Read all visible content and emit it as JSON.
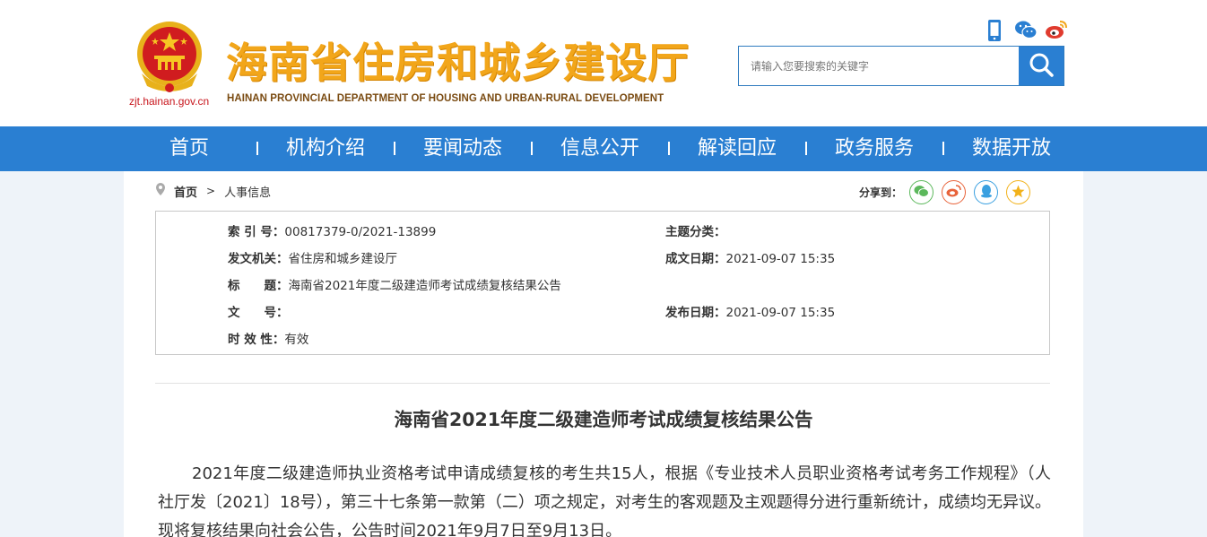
{
  "header": {
    "domain": "zjt.hainan.gov.cn",
    "title": "海南省住房和城乡建设厅",
    "subtitle": "HAINAN PROVINCIAL DEPARTMENT OF HOUSING AND URBAN-RURAL DEVELOPMENT",
    "search_placeholder": "请输入您要搜索的关键字",
    "icons": [
      "mobile-icon",
      "wechat-icon",
      "weibo-icon",
      "search-icon"
    ]
  },
  "nav": {
    "items": [
      {
        "label": "首页"
      },
      {
        "label": "机构介绍"
      },
      {
        "label": "要闻动态"
      },
      {
        "label": "信息公开"
      },
      {
        "label": "解读回应"
      },
      {
        "label": "政务服务"
      },
      {
        "label": "数据开放"
      }
    ]
  },
  "breadcrumb": {
    "home": "首页",
    "separator": ">",
    "current": "人事信息"
  },
  "share": {
    "label": "分享到：",
    "icons": [
      "wechat-icon",
      "weibo-icon",
      "qq-icon",
      "qzone-icon"
    ]
  },
  "meta": {
    "index_label": "索 引 号：",
    "index_value": "00817379-0/2021-13899",
    "topic_label": "主题分类：",
    "topic_value": "",
    "issuer_label": "发文机关：",
    "issuer_value": "省住房和城乡建设厅",
    "written_label": "成文日期：",
    "written_value": "2021-09-07 15:35",
    "title_label": "标　　题：",
    "title_value": "海南省2021年度二级建造师考试成绩复核结果公告",
    "docno_label": "文　　号：",
    "docno_value": "",
    "published_label": "发布日期：",
    "published_value": "2021-09-07 15:35",
    "validity_label": "时 效 性：",
    "validity_value": "有效"
  },
  "article": {
    "title": "海南省2021年度二级建造师考试成绩复核结果公告",
    "body": "2021年度二级建造师执业资格考试申请成绩复核的考生共15人，根据《专业技术人员职业资格考试考务工作规程》（人社厅发〔2021〕18号），第三十七条第一款第（二）项之规定，对考生的客观题及主观题得分进行重新统计，成绩均无异议。现将复核结果向社会公告，公告时间2021年9月7日至9月13日。"
  },
  "colors": {
    "nav_bg": "#2a7fd2",
    "title_gold": "#f2a61a",
    "emblem_red": "#c8161d"
  }
}
